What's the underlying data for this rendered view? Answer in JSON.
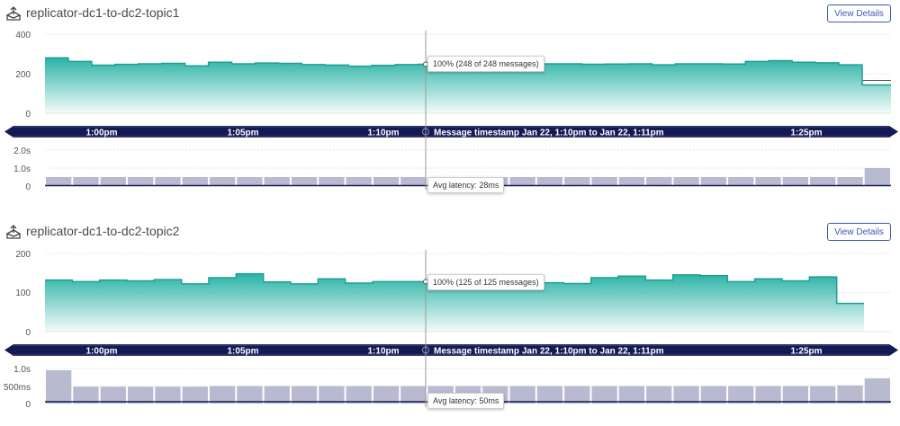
{
  "panels": [
    {
      "title": "replicator-dc1-to-dc2-topic1",
      "icon": "topic-icon",
      "view_details_label": "View Details",
      "tooltip_top": "100% (248 of 248 messages)",
      "tooltip_bottom": "Avg latency: 28ms",
      "timeline": {
        "labels": [
          "1:00pm",
          "1:05pm",
          "1:10pm",
          "1:25pm"
        ],
        "selection_label": "Message timestamp Jan 22, 1:10pm to Jan 22, 1:11pm"
      },
      "top_y_ticks": [
        "400",
        "200",
        "0"
      ],
      "bottom_y_ticks": [
        "2.0s",
        "1.0s",
        "0"
      ]
    },
    {
      "title": "replicator-dc1-to-dc2-topic2",
      "icon": "topic-icon",
      "view_details_label": "View Details",
      "tooltip_top": "100% (125 of 125 messages)",
      "tooltip_bottom": "Avg latency: 50ms",
      "timeline": {
        "labels": [
          "1:00pm",
          "1:05pm",
          "1:10pm",
          "1:25pm"
        ],
        "selection_label": "Message timestamp Jan 22, 1:10pm to Jan 22, 1:11pm"
      },
      "top_y_ticks": [
        "200",
        "100",
        "0"
      ],
      "bottom_y_ticks": [
        "1.0s",
        "500ms",
        "0"
      ]
    }
  ],
  "chart_data": [
    {
      "type": "area",
      "ylim": [
        0,
        400
      ],
      "values": [
        280,
        262,
        243,
        247,
        250,
        252,
        240,
        258,
        250,
        254,
        252,
        246,
        244,
        238,
        242,
        246,
        248,
        250,
        250,
        249,
        252,
        250,
        250,
        248,
        249,
        250,
        245,
        250,
        250,
        249,
        262,
        266,
        258,
        255,
        245
      ],
      "partial_last": 143,
      "color": "#2ab3a6"
    },
    {
      "type": "bar",
      "ylim": [
        0,
        2.0
      ],
      "values": [
        0.5,
        0.5,
        0.5,
        0.5,
        0.5,
        0.5,
        0.5,
        0.5,
        0.5,
        0.5,
        0.5,
        0.5,
        0.5,
        0.5,
        0.5,
        0.5,
        0.5,
        0.5,
        0.5,
        0.5,
        0.5,
        0.5,
        0.5,
        0.5,
        0.5,
        0.5,
        0.5,
        0.5,
        0.5,
        0.5,
        1.0
      ],
      "avg_line": 0.028,
      "color": "#b8bbcf"
    },
    {
      "type": "area",
      "ylim": [
        0,
        200
      ],
      "values": [
        132,
        128,
        132,
        130,
        133,
        122,
        138,
        148,
        127,
        122,
        135,
        124,
        128,
        128,
        125,
        128,
        130,
        135,
        125,
        123,
        138,
        142,
        132,
        145,
        143,
        128,
        135,
        130,
        140,
        72
      ],
      "color": "#2ab3a6"
    },
    {
      "type": "bar",
      "ylim": [
        0,
        1.0
      ],
      "values": [
        0.95,
        0.48,
        0.48,
        0.48,
        0.48,
        0.48,
        0.5,
        0.5,
        0.5,
        0.5,
        0.5,
        0.5,
        0.5,
        0.5,
        0.5,
        0.5,
        0.5,
        0.5,
        0.5,
        0.5,
        0.5,
        0.5,
        0.5,
        0.5,
        0.5,
        0.5,
        0.5,
        0.5,
        0.5,
        0.52,
        0.72
      ],
      "avg_line": 0.05,
      "color": "#b8bbcf"
    }
  ]
}
